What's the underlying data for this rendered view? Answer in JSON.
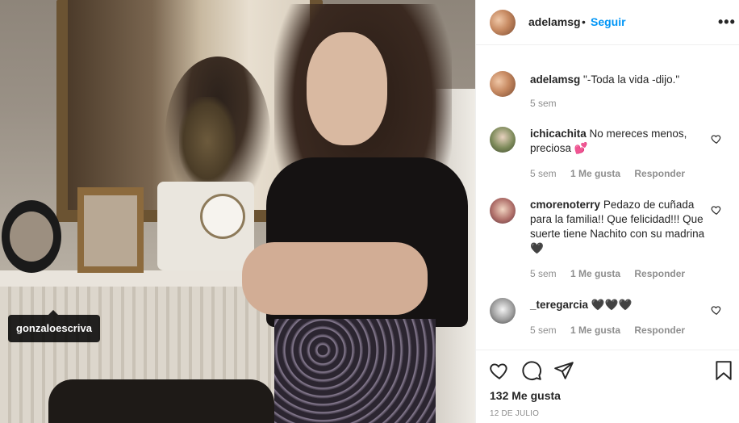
{
  "photo": {
    "tag": "gonzaloescriva"
  },
  "header": {
    "username": "adelamsg",
    "separator": "•",
    "follow_label": "Seguir",
    "more_icon": "more-horizontal-icon",
    "more_label": "•••"
  },
  "caption": {
    "username": "adelamsg",
    "text": "\"-Toda la vida -dijo.\"",
    "time": "5 sem"
  },
  "comments": [
    {
      "username": "ichicachita",
      "text": "No mereces menos, preciosa 💕",
      "time": "5 sem",
      "likes": "1 Me gusta",
      "reply_label": "Responder"
    },
    {
      "username": "cmorenoterry",
      "text": "Pedazo de cuñada para la familia!! Que felicidad!!! Que suerte tiene Nachito con su madrina 🖤",
      "time": "5 sem",
      "likes": "1 Me gusta",
      "reply_label": "Responder"
    },
    {
      "username": "_teregarcia",
      "text": "🖤🖤🖤",
      "time": "5 sem",
      "likes": "1 Me gusta",
      "reply_label": "Responder"
    }
  ],
  "footer": {
    "likes": "132 Me gusta",
    "date": "12 DE JULIO"
  },
  "icons": {
    "like": "heart-icon",
    "comment": "comment-icon",
    "share": "share-icon",
    "save": "bookmark-icon"
  },
  "colors": {
    "accent": "#0095f6",
    "text": "#262626",
    "muted": "#8e8e8e",
    "divider": "#efefef"
  }
}
